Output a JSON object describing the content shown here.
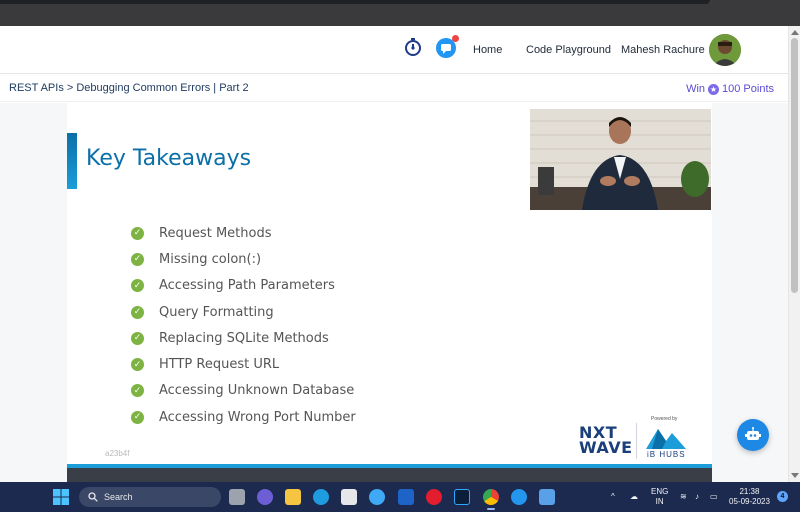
{
  "header": {
    "nav": {
      "home": "Home",
      "code_playground": "Code Playground",
      "user_name": "Mahesh Rachure"
    },
    "icons": {
      "timer": "stopwatch-icon",
      "chat": "chat-icon"
    }
  },
  "breadcrumb": {
    "text": "REST APIs > Debugging Common Errors | Part 2"
  },
  "reward": {
    "prefix": "Win",
    "points": "100 Points"
  },
  "slide": {
    "title": "Key Takeaways",
    "items": [
      "Request Methods",
      "Missing colon(:)",
      "Accessing Path Parameters",
      "Query Formatting",
      "Replacing SQLite Methods",
      "HTTP Request URL",
      "Accessing Unknown Database",
      "Accessing Wrong Port Number"
    ],
    "slide_id": "a23b4f",
    "logo_nxtwave_line1": "NXT",
    "logo_nxtwave_line2": "WAVE",
    "powered_by": "Powered by",
    "ib_hubs": "iB HUBS"
  },
  "taskbar": {
    "search_placeholder": "Search",
    "language_line1": "ENG",
    "language_line2": "IN",
    "time": "21:38",
    "date": "05-09-2023",
    "notification_count": "4"
  },
  "colors": {
    "accent": "#0b6fa8",
    "check": "#7cb342",
    "reward": "#5b4bd0",
    "taskbar": "#1c2a4f"
  }
}
